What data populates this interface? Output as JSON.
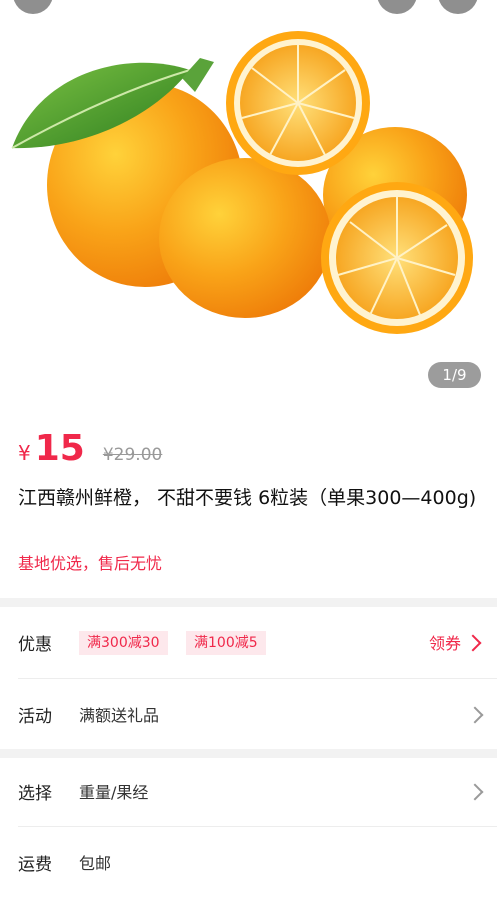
{
  "gallery": {
    "counter": "1/9"
  },
  "product": {
    "currency": "¥",
    "price": "15",
    "original_price": "¥29.00",
    "title": "江西赣州鲜橙， 不甜不要钱 6粒装（单果300—400g)",
    "slogan": "基地优选，售后无忧"
  },
  "promo": {
    "label": "优惠",
    "tags": [
      "满300减30",
      "满100减5"
    ],
    "link": "领券"
  },
  "activity": {
    "label": "活动",
    "value": "满额送礼品"
  },
  "select": {
    "label": "选择",
    "value": "重量/果经"
  },
  "shipping": {
    "label": "运费",
    "value": "包邮"
  },
  "colors": {
    "accent": "#f0284a",
    "orange": "#f7a21c",
    "leaf": "#3c9a2a"
  }
}
